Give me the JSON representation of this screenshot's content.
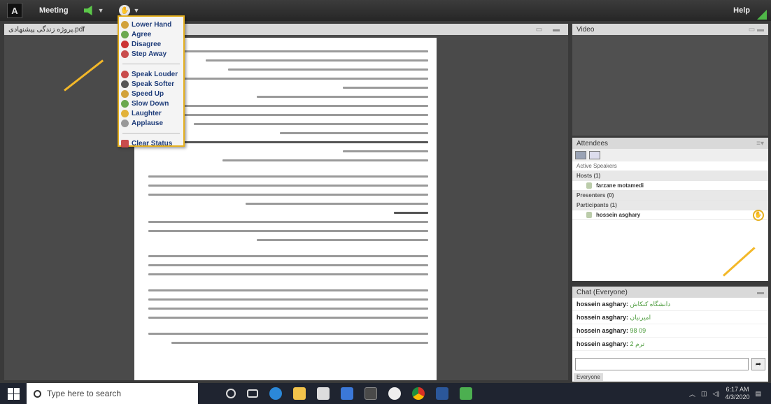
{
  "topbar": {
    "logo": "A",
    "meeting_label": "Meeting",
    "help_label": "Help",
    "speaker_icon": "speaker-icon",
    "status_icon": "raise-hand-icon"
  },
  "share_pod": {
    "filename": "پروژه زندگی پیشنهادی.pdf"
  },
  "status_menu": {
    "items": [
      {
        "label": "Lower Hand",
        "icon": "lower-hand-icon",
        "color": "#d2a23a"
      },
      {
        "label": "Agree",
        "icon": "agree-icon",
        "color": "#6aa84f"
      },
      {
        "label": "Disagree",
        "icon": "disagree-icon",
        "color": "#cc3333"
      },
      {
        "label": "Step Away",
        "icon": "step-away-icon",
        "color": "#c94c4c"
      }
    ],
    "items2": [
      {
        "label": "Speak Louder",
        "icon": "speak-louder-icon",
        "color": "#c94c4c"
      },
      {
        "label": "Speak Softer",
        "icon": "speak-softer-icon",
        "color": "#555555"
      },
      {
        "label": "Speed Up",
        "icon": "speed-up-icon",
        "color": "#d2a23a"
      },
      {
        "label": "Slow Down",
        "icon": "slow-down-icon",
        "color": "#6aa84f"
      },
      {
        "label": "Laughter",
        "icon": "laughter-icon",
        "color": "#e2b23a"
      },
      {
        "label": "Applause",
        "icon": "applause-icon",
        "color": "#999999"
      }
    ],
    "clear_label": "Clear Status"
  },
  "video_pod": {
    "title": "Video"
  },
  "attendees": {
    "title": "Attendees",
    "active_speakers": "Active Speakers",
    "hosts_header": "Hosts (1)",
    "host_name": "farzane motamedi",
    "presenters_header": "Presenters (0)",
    "participants_header": "Participants (1)",
    "participant_name": "hossein asghary"
  },
  "chat": {
    "title": "Chat (Everyone)",
    "messages": [
      {
        "name": "hossein asghary:",
        "text": "دانشگاه کنکاش"
      },
      {
        "name": "hossein asghary:",
        "text": "امیرنیان"
      },
      {
        "name": "hossein asghary:",
        "text": "98 09"
      },
      {
        "name": "hossein asghary:",
        "text": "ترم 2"
      }
    ],
    "tab_label": "Everyone"
  },
  "taskbar": {
    "search_placeholder": "Type here to search",
    "time": "6:17 AM",
    "date": "4/3/2020"
  }
}
